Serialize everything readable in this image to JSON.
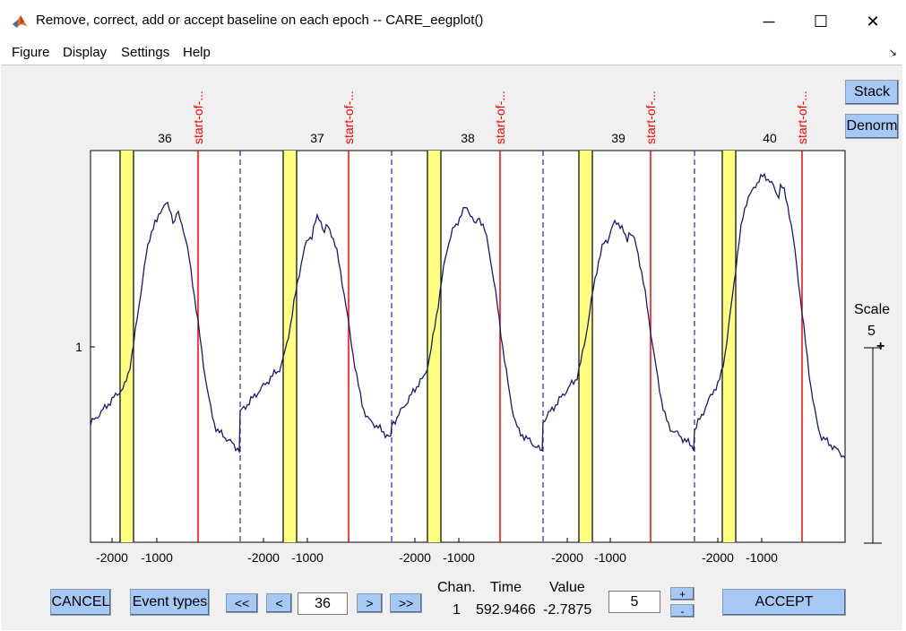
{
  "window": {
    "title": "Remove, correct, add or accept baseline on each epoch -- CARE_eegplot()",
    "minimize": "─",
    "maximize": "☐",
    "close": "✕"
  },
  "menu": {
    "items": [
      "Figure",
      "Display",
      "Settings",
      "Help"
    ],
    "dock_arrow": "↘"
  },
  "side_buttons": {
    "stack": "Stack",
    "denorm": "Denorm"
  },
  "scale": {
    "label": "Scale",
    "value": "5",
    "plus": "+"
  },
  "plot": {
    "y_tick": "1",
    "epochs": [
      "36",
      "37",
      "38",
      "39",
      "40"
    ],
    "event_label": "start-of-...",
    "x_tick_labels": [
      "-2000",
      "-1000"
    ],
    "colors": {
      "trace": "#1a1a6e",
      "event_line": "#ff0000",
      "epoch_boundary": "#2020cc",
      "baseline_fill": "#ffff80"
    }
  },
  "controls": {
    "cancel": "CANCEL",
    "event_types": "Event types",
    "first": "<<",
    "prev": "<",
    "epoch_value": "36",
    "next": ">",
    "last": ">>",
    "chan_header": "Chan.",
    "time_header": "Time",
    "value_header": "Value",
    "chan_value": "1",
    "time_value": "592.9466",
    "value_value": "-2.7875",
    "scale_value": "5",
    "scale_up": "+",
    "scale_down": "-",
    "accept": "ACCEPT"
  }
}
